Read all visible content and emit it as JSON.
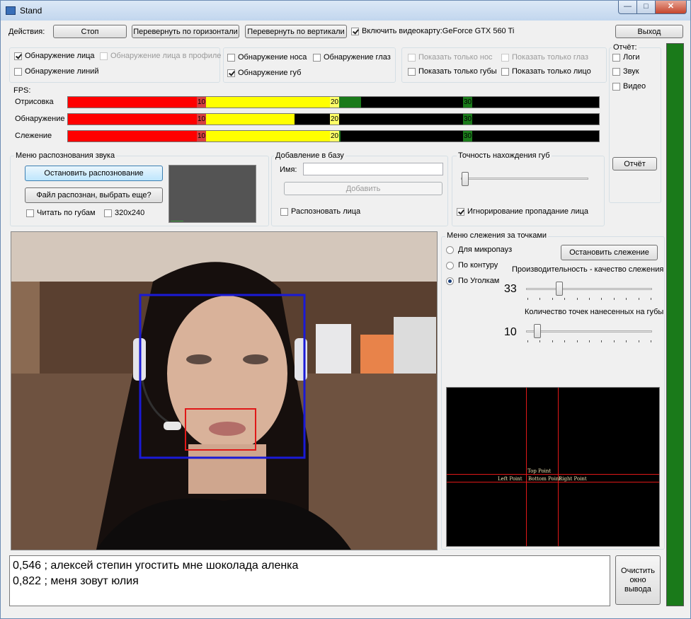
{
  "window": {
    "title": "Stand"
  },
  "toolbar": {
    "actions_label": "Действия:",
    "stop": "Стоп",
    "flip_horizontal": "Перевернуть по горизонтали",
    "flip_vertical": "Перевернуть по вертикали",
    "gpu_label": "Включить видеокарту:GeForce GTX 560 Ti",
    "exit": "Выход"
  },
  "detection": {
    "face": "Обнаружение лица",
    "face_profile": "Обнаружение лица в профиле",
    "lines": "Обнаружение линий",
    "nose": "Обнаружение носа",
    "eyes": "Обнаружение глаз",
    "lips": "Обнаружение губ"
  },
  "show_only": {
    "nose": "Показать только нос",
    "eyes": "Показать только глаз",
    "lips": "Показать только губы",
    "face": "Показать только лицо"
  },
  "report": {
    "label": "Отчёт:",
    "logs": "Логи",
    "sound": "Звук",
    "video": "Видео",
    "button": "Отчёт"
  },
  "fps": {
    "label": "FPS:",
    "rows": [
      {
        "label": "Отрисовка",
        "value": 22
      },
      {
        "label": "Обнаружение",
        "value": 17
      },
      {
        "label": "Слежение",
        "value": 20.5
      }
    ],
    "tick_labels": [
      "10",
      "20",
      "30"
    ]
  },
  "sound_menu": {
    "title": "Меню распознования звука",
    "stop_recognition": "Остановить распознование",
    "file_recognized": "Файл распознан, выбрать еще?",
    "lip_reading": "Читать по губам",
    "resolution": "320x240"
  },
  "add_db": {
    "title": "Добавление в базу",
    "name_label": "Имя:",
    "name_value": "",
    "add": "Добавить",
    "recognize_faces": "Распозновать лица"
  },
  "lip_accuracy": {
    "title": "Точность нахождения губ",
    "ignore_face_loss": "Игнорирование пропадание лица"
  },
  "tracking": {
    "title": "Меню слежения за точками",
    "micropause": "Для микропауз",
    "contour": "По контуру",
    "corners": "По Уголкам",
    "stop_tracking": "Остановить слежение",
    "perf_label": "Производительность - качество слежения",
    "perf_value": "33",
    "points_label": "Количество точек нанесенных на губы",
    "points_value": "10"
  },
  "points_view": {
    "top": "Top Point",
    "left": "Left Point",
    "bottom": "Bottom Point",
    "right": "Right Point"
  },
  "output": {
    "lines": [
      "0,546 ; алексей степин угостить мне шоколада аленка",
      "0,822 ; меня зовут юлия"
    ],
    "clear": "Очистить окно вывода"
  },
  "colors": {
    "red": "#ff0000",
    "yellow": "#ffff00",
    "green": "#1a7a1a",
    "black": "#000000"
  }
}
